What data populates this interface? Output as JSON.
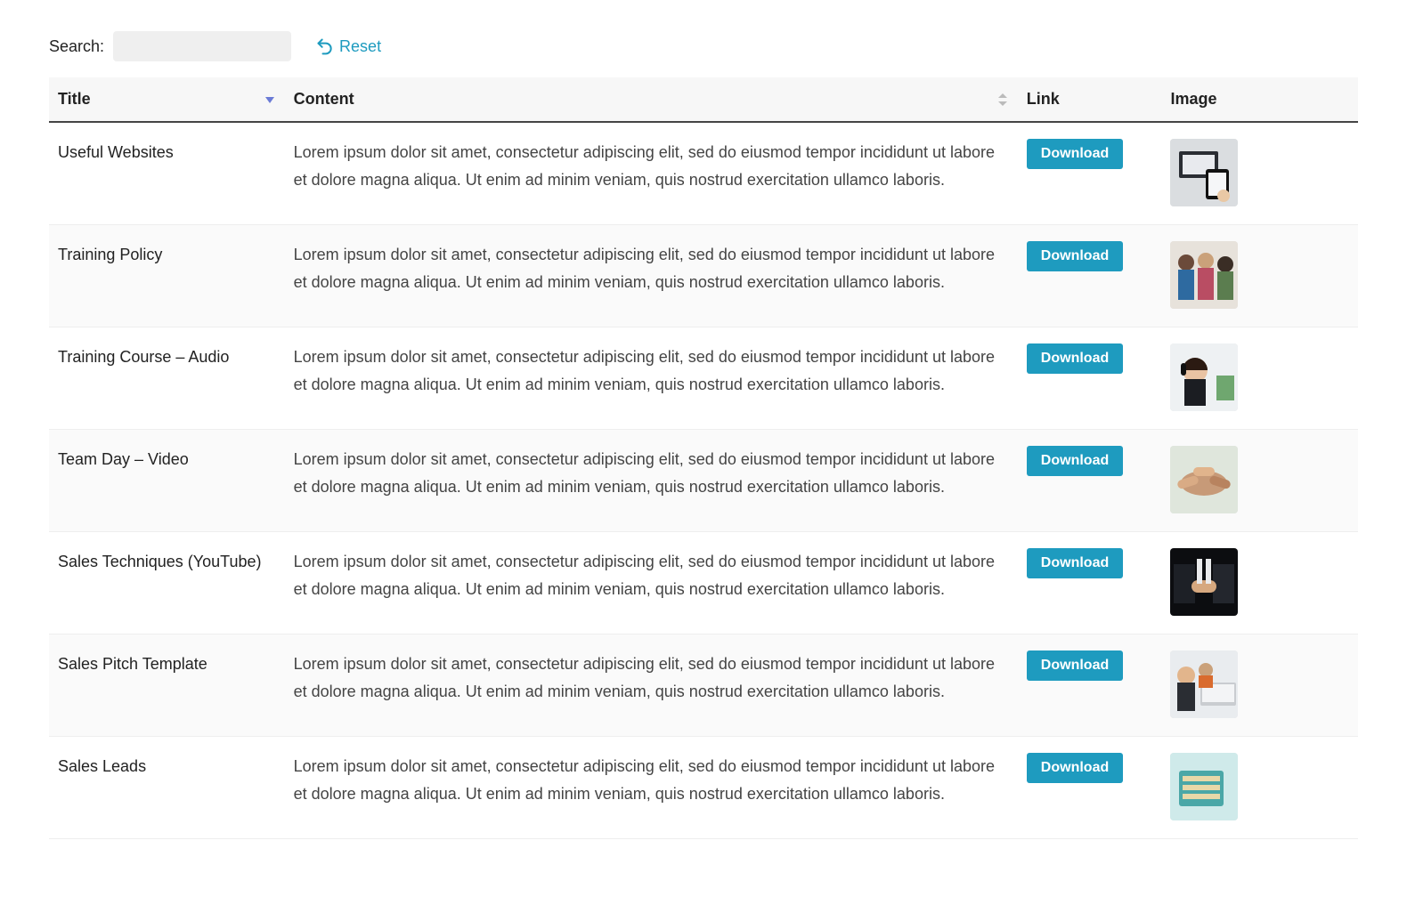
{
  "search": {
    "label": "Search:",
    "value": ""
  },
  "reset": {
    "label": "Reset"
  },
  "columns": {
    "title": "Title",
    "content": "Content",
    "link": "Link",
    "image": "Image"
  },
  "button_label": "Download",
  "lorem": "Lorem ipsum dolor sit amet, consectetur adipiscing elit, sed do eiusmod tempor incididunt ut labore et dolore magna aliqua. Ut enim ad minim veniam, quis nostrud exercitation ullamco laboris.",
  "rows": [
    {
      "title": "Useful Websites",
      "thumb": "devices"
    },
    {
      "title": "Training Policy",
      "thumb": "people-back"
    },
    {
      "title": "Training Course – Audio",
      "thumb": "headset-woman"
    },
    {
      "title": "Team Day – Video",
      "thumb": "hands-stack"
    },
    {
      "title": "Sales Techniques (YouTube)",
      "thumb": "handshake"
    },
    {
      "title": "Sales Pitch Template",
      "thumb": "laptop-team"
    },
    {
      "title": "Sales Leads",
      "thumb": "files"
    }
  ]
}
